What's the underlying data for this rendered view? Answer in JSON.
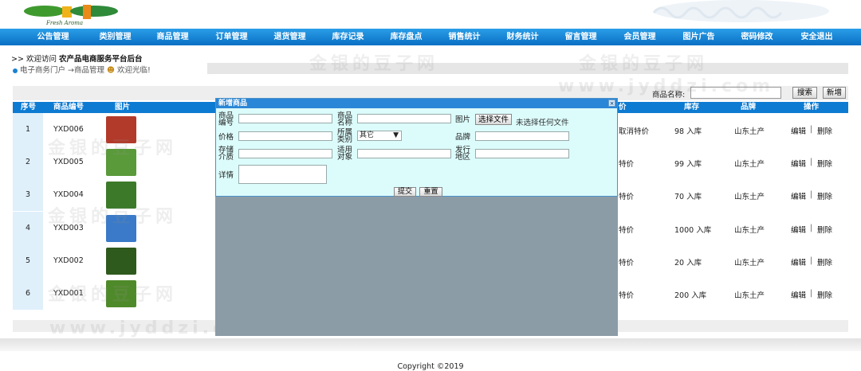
{
  "nav": [
    {
      "label": "公告管理"
    },
    {
      "label": "类别管理"
    },
    {
      "label": "商品管理"
    },
    {
      "label": "订单管理"
    },
    {
      "label": "退货管理"
    },
    {
      "label": "库存记录"
    },
    {
      "label": "库存盘点"
    },
    {
      "label": "销售统计"
    },
    {
      "label": "财务统计"
    },
    {
      "label": "留言管理"
    },
    {
      "label": "会员管理"
    },
    {
      "label": "图片广告"
    },
    {
      "label": "密码修改"
    },
    {
      "label": "安全退出"
    }
  ],
  "welcome": {
    "prefix": ">> 欢迎访问 ",
    "site": "农产品电商服务平台后台"
  },
  "breadcrumb": {
    "text": "电子商务门户 →商品管理",
    "greeting": "欢迎光临!"
  },
  "search": {
    "label": "商品名称:",
    "value": "",
    "search_button": "搜索",
    "add_button": "新增"
  },
  "table": {
    "headers": {
      "seq": "序号",
      "code": "商品编号",
      "pic": "图片",
      "price": "价",
      "stock": "库存",
      "brand": "品牌",
      "ops": "操作"
    },
    "rows": [
      {
        "seq": "1",
        "code": "YXD006",
        "price": "取消特价",
        "stock": "98 入库",
        "brand": "山东土产",
        "edit": "编辑",
        "delete": "删除",
        "pic_color": "#b23a2a"
      },
      {
        "seq": "2",
        "code": "YXD005",
        "price": "特价",
        "stock": "99 入库",
        "brand": "山东土产",
        "edit": "编辑",
        "delete": "删除",
        "pic_color": "#5a9a3a"
      },
      {
        "seq": "3",
        "code": "YXD004",
        "price": "特价",
        "stock": "70 入库",
        "brand": "山东土产",
        "edit": "编辑",
        "delete": "删除",
        "pic_color": "#3c7a2a"
      },
      {
        "seq": "4",
        "code": "YXD003",
        "price": "特价",
        "stock": "1000 入库",
        "brand": "山东土产",
        "edit": "编辑",
        "delete": "删除",
        "pic_color": "#3a7ac8"
      },
      {
        "seq": "5",
        "code": "YXD002",
        "price": "特价",
        "stock": "20 入库",
        "brand": "山东土产",
        "edit": "编辑",
        "delete": "删除",
        "pic_color": "#2f5a1e"
      },
      {
        "seq": "6",
        "code": "YXD001",
        "price": "特价",
        "stock": "200 入库",
        "brand": "山东土产",
        "edit": "编辑",
        "delete": "删除",
        "pic_color": "#4f8a2a"
      }
    ]
  },
  "dialog": {
    "title": "新增商品",
    "close": "×",
    "labels": {
      "code": "商品编号",
      "name": "商品名称",
      "picture": "图片",
      "price": "价格",
      "category": "所属类别",
      "brand": "品牌",
      "storage": "存储介质",
      "target": "适用对象",
      "origin": "发行地区",
      "detail": "详情"
    },
    "file_button": "选择文件",
    "file_status": "未选择任何文件",
    "category_selected": "其它",
    "submit": "提交",
    "reset": "重置"
  },
  "watermark": {
    "cn": "金银的豆子网",
    "en": "www.jyddzi.com"
  },
  "footer": {
    "copyright": "Copyright ©2019"
  },
  "colors": {
    "nav": "#0a6fc4",
    "header_row": "#0e7bd2",
    "dialog_bg": "#dcfbfb",
    "overlay": "#8c9ca7"
  }
}
